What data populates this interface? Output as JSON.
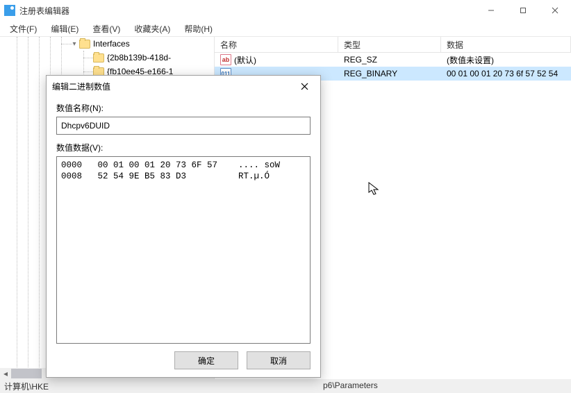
{
  "window": {
    "title": "注册表编辑器"
  },
  "menus": {
    "file": "文件(F)",
    "edit": "编辑(E)",
    "view": "查看(V)",
    "favorites": "收藏夹(A)",
    "help": "帮助(H)"
  },
  "tree": {
    "node1": {
      "label": "Interfaces"
    },
    "node2": {
      "label": "{2b8b139b-418d-"
    },
    "node3": {
      "label": "{fb10ee45-e166-1"
    }
  },
  "list": {
    "cols": {
      "name": "名称",
      "type": "类型",
      "data": "数据"
    },
    "rows": [
      {
        "icon": "str",
        "icon_text": "ab",
        "name": "(默认)",
        "type": "REG_SZ",
        "data": "(数值未设置)"
      },
      {
        "icon": "bin",
        "icon_text": "011",
        "name": "",
        "type": "REG_BINARY",
        "data": "00 01 00 01 20 73 6f 57 52 54"
      }
    ]
  },
  "dialog": {
    "title": "编辑二进制数值",
    "name_label": "数值名称(N):",
    "name_value": "Dhcpv6DUID",
    "data_label": "数值数据(V):",
    "hex": "0000   00 01 00 01 20 73 6F 57    .... soW\n0008   52 54 9E B5 83 D3          RT.µ.Ó",
    "ok": "确定",
    "cancel": "取消"
  },
  "statusbar": {
    "left": "计算机\\HKE",
    "right": "p6\\Parameters"
  }
}
